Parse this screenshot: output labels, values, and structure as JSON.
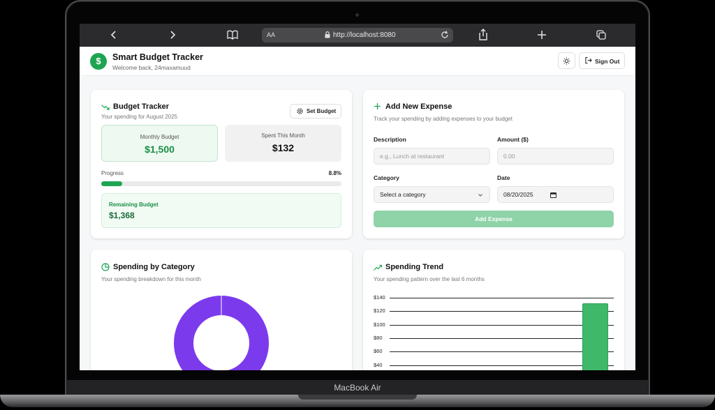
{
  "device": {
    "label": "MacBook Air"
  },
  "browser": {
    "aa": "AA",
    "url": "http://localhost:8080"
  },
  "app": {
    "title": "Smart Budget Tracker",
    "welcome": "Welcome back, 24maxamuud",
    "sign_out": "Sign Out"
  },
  "budget": {
    "title": "Budget Tracker",
    "subtitle": "Your spending for August 2025",
    "set_budget": "Set Budget",
    "monthly_label": "Monthly Budget",
    "monthly_value": "$1,500",
    "spent_label": "Spent This Month",
    "spent_value": "$132",
    "progress_label": "Progress",
    "progress_text": "8.8%",
    "progress_fraction": 0.088,
    "remaining_label": "Remaining Budget",
    "remaining_value": "$1,368"
  },
  "expense_form": {
    "title": "Add New Expense",
    "subtitle": "Track your spending by adding expenses to your budget",
    "description_label": "Description",
    "description_placeholder": "e.g., Lunch at restaurant",
    "amount_label": "Amount ($)",
    "amount_placeholder": "0.00",
    "category_label": "Category",
    "category_value": "Select a category",
    "date_label": "Date",
    "date_value": "08/20/2025",
    "submit": "Add Expense"
  },
  "category_chart": {
    "title": "Spending by Category",
    "subtitle": "Your spending breakdown for this month"
  },
  "trend_chart": {
    "title": "Spending Trend",
    "subtitle": "Your spending pattern over the last 6 months"
  },
  "colors": {
    "accent": "#1fa552",
    "donut": "#7c3aed",
    "bar": "#3fb86a"
  },
  "chart_data": [
    {
      "type": "pie",
      "title": "",
      "slices": [
        {
          "label": "",
          "value": 132
        }
      ]
    },
    {
      "type": "bar",
      "title": "",
      "ytick_labels": [
        "$140",
        "$120",
        "$100",
        "$80",
        "$60",
        "$40"
      ],
      "ylim": [
        40,
        140
      ],
      "values": [
        0,
        0,
        0,
        0,
        0,
        132
      ],
      "grid": true
    }
  ]
}
